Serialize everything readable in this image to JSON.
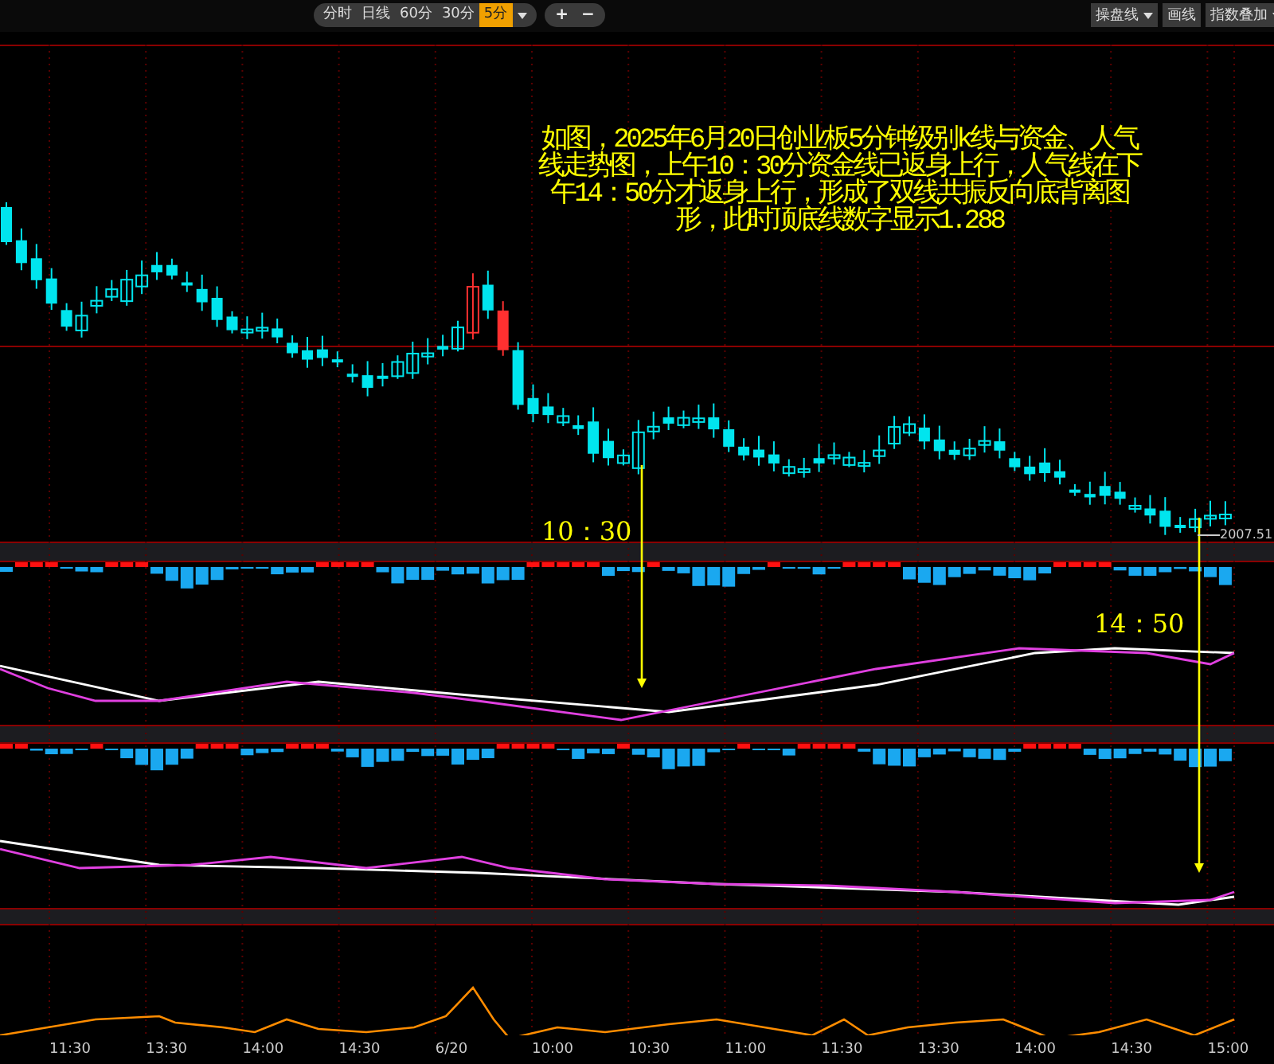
{
  "toolbar": {
    "period_tabs": [
      {
        "label": "分时",
        "selected": false
      },
      {
        "label": "日线",
        "selected": false
      },
      {
        "label": "60分",
        "selected": false
      },
      {
        "label": "30分",
        "selected": false
      },
      {
        "label": "5分",
        "selected": true
      }
    ],
    "zoom_buttons": [
      "+",
      "−"
    ],
    "tools": [
      {
        "label": "操盘线",
        "kind": "dropdown"
      },
      {
        "label": "画线",
        "kind": "button"
      },
      {
        "label": "指数叠加",
        "kind": "dropdown"
      }
    ]
  },
  "chart": {
    "annotation": "如图，2025年6月20日创业板5分钟级别k线与资金、人气线走势图，上午10：30分资金线已返身上行，人气线在下午14：50分才返身上行，形成了双线共振反向底背离图形，此时顶底线数字显示1.288",
    "markers": [
      {
        "label": "10：30"
      },
      {
        "label": "14：50"
      }
    ],
    "last_price": "2007.51",
    "x_axis": [
      "11:30",
      "13:30",
      "14:00",
      "14:30",
      "6/20",
      "10:00",
      "10:30",
      "11:00",
      "11:30",
      "13:30",
      "14:00",
      "14:30",
      "15:00"
    ]
  }
}
